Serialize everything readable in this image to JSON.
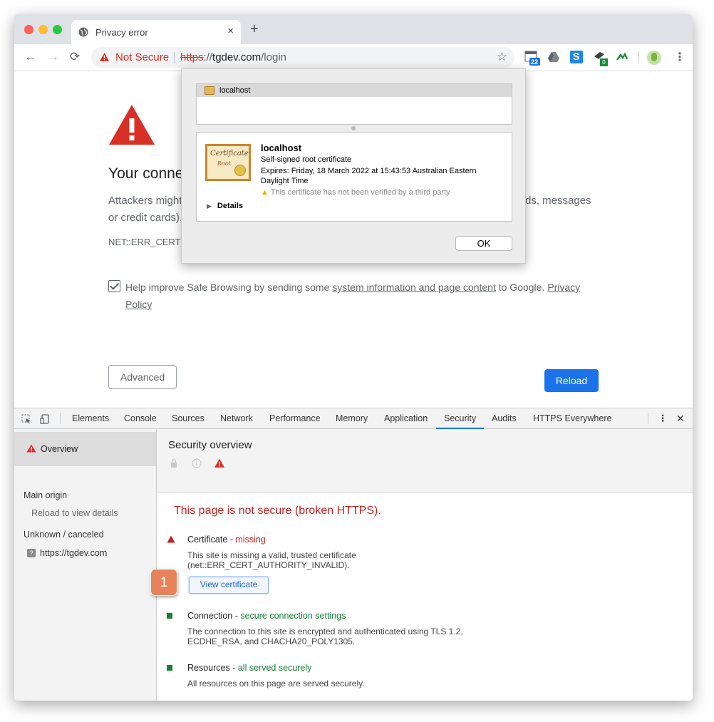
{
  "tab": {
    "title": "Privacy error",
    "close": "×",
    "new_tab": "+"
  },
  "toolbar": {
    "back": "←",
    "forward": "→",
    "refresh": "⟳",
    "not_secure": "Not Secure",
    "url_scheme": "https",
    "url_sep": "://",
    "url_host": "tgdev.com",
    "url_path": "/login",
    "bookmark": "☆",
    "ext_badge_1": "22",
    "ext_badge_2": "0",
    "menu": "⋮"
  },
  "page": {
    "heading": "Your conne",
    "para_line1": "Attackers might",
    "para_right": "rds, messages",
    "para_line2": "or credit cards).",
    "error_code": "NET::ERR_CERT_",
    "safe_browsing_pre": "Help improve Safe Browsing by sending some ",
    "safe_browsing_link": "system information and page content",
    "safe_browsing_mid": " to Google. ",
    "privacy_policy": "Privacy Policy",
    "advanced": "Advanced",
    "reload": "Reload"
  },
  "cert_dialog": {
    "list_item": "localhost",
    "image_script": "Certificate",
    "image_script2": "Root",
    "name": "localhost",
    "type": "Self-signed root certificate",
    "expires_line1": "Expires: Friday, 18 March 2022 at 15:43:53 Australian Eastern",
    "expires_line2": "Daylight Time",
    "warning": "This certificate has not been verified by a third party",
    "details": "Details",
    "ok": "OK"
  },
  "devtools": {
    "tabs": [
      "Elements",
      "Console",
      "Sources",
      "Network",
      "Performance",
      "Memory",
      "Application",
      "Security",
      "Audits",
      "HTTPS Everywhere"
    ],
    "active_tab": "Security",
    "close": "✕",
    "sidebar": {
      "overview": "Overview",
      "main_origin": "Main origin",
      "reload_details": "Reload to view details",
      "unknown": "Unknown / canceled",
      "origin_url": "https://tgdev.com",
      "q": "?"
    },
    "main": {
      "title": "Security overview",
      "broken": "This page is not secure (broken HTTPS).",
      "cert_label": "Certificate - ",
      "cert_status": "missing",
      "cert_desc1": "This site is missing a valid, trusted certificate",
      "cert_desc2": "(net::ERR_CERT_AUTHORITY_INVALID).",
      "view_cert": "View certificate",
      "conn_label": "Connection - ",
      "conn_status": "secure connection settings",
      "conn_desc1": "The connection to this site is encrypted and authenticated using TLS 1.2,",
      "conn_desc2": "ECDHE_RSA, and CHACHA20_POLY1305.",
      "res_label": "Resources - ",
      "res_status": "all served securely",
      "res_desc": "All resources on this page are served securely."
    }
  },
  "callout": {
    "number": "1"
  },
  "colors": {
    "accent": "#1a73e8",
    "danger": "#d93025",
    "secure": "#188038",
    "callout": "#e8825a"
  }
}
